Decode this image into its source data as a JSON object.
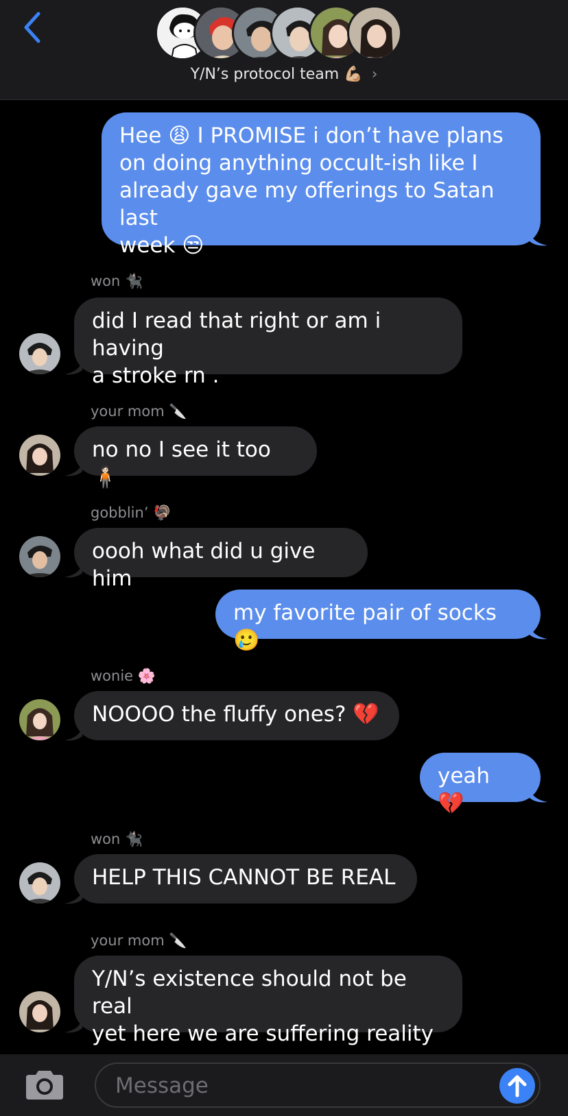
{
  "header": {
    "group_name": "Y/N’s protocol team",
    "group_emoji": "💪🏼",
    "chevron": "›"
  },
  "messages": [
    {
      "dir": "out",
      "text": "Hee 😩 I PROMISE i don’t have plans\non doing anything occult-ish like I\nalready gave my offerings to Satan last\nweek 😒"
    },
    {
      "dir": "in",
      "sender": "won 🐈‍⬛",
      "text": "did I read that right or am i having\na stroke rn ."
    },
    {
      "dir": "in",
      "sender": "your mom 🔪",
      "text": "no no I see it too 🧍🏻"
    },
    {
      "dir": "in",
      "sender": "gobblin’ 🦃",
      "text": "oooh what did u give him"
    },
    {
      "dir": "out",
      "text": "my favorite pair of socks 🥲"
    },
    {
      "dir": "in",
      "sender": "wonie 🌸",
      "text": "NOOOO the fluffy ones? 💔"
    },
    {
      "dir": "out",
      "text": "yeah 💔"
    },
    {
      "dir": "in",
      "sender": "won 🐈‍⬛",
      "text": "HELP THIS CANNOT BE REAL"
    },
    {
      "dir": "in",
      "sender": "your mom 🔪",
      "text": "Y/N’s existence should not be real\nyet here we are suffering reality"
    }
  ],
  "composer": {
    "placeholder": "Message"
  },
  "icons": {
    "back": "chevron-left-icon",
    "camera": "camera-icon",
    "send": "arrow-up-icon"
  },
  "colors": {
    "incoming_bubble": "#262628",
    "outgoing_bubble": "#5b8dec",
    "accent": "#3b82f6",
    "header_bg": "#1b1b1d"
  }
}
